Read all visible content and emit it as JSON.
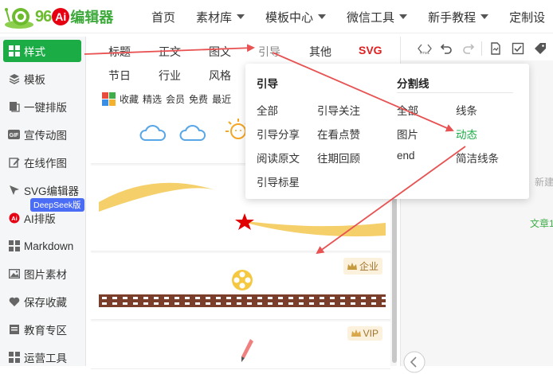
{
  "logo": {
    "num": "96",
    "ai": "Ai",
    "text": "编辑器"
  },
  "nav": [
    {
      "label": "首页",
      "caret": false
    },
    {
      "label": "素材库",
      "caret": true
    },
    {
      "label": "模板中心",
      "caret": true
    },
    {
      "label": "微信工具",
      "caret": true
    },
    {
      "label": "新手教程",
      "caret": true
    },
    {
      "label": "定制设",
      "caret": false
    }
  ],
  "sidebar": {
    "items": [
      {
        "label": "样式",
        "icon": "grid-icon"
      },
      {
        "label": "模板",
        "icon": "layers-icon"
      },
      {
        "label": "一键排版",
        "icon": "format-icon"
      },
      {
        "label": "宣传动图",
        "icon": "gif-icon"
      },
      {
        "label": "在线作图",
        "icon": "edit-icon"
      },
      {
        "label": "SVG编辑器",
        "icon": "pointer-icon"
      },
      {
        "label": "AI排版",
        "icon": "ai-icon"
      },
      {
        "label": "Markdown",
        "icon": "grid-icon"
      },
      {
        "label": "图片素材",
        "icon": "image-icon"
      },
      {
        "label": "保存收藏",
        "icon": "heart-icon"
      },
      {
        "label": "教育专区",
        "icon": "book-icon"
      },
      {
        "label": "运营工具",
        "icon": "grid-icon"
      }
    ],
    "deepseek_badge": "DeepSeek版"
  },
  "tabs": {
    "row1": [
      "标题",
      "正文",
      "图文",
      "引导",
      "其他",
      "SVG"
    ],
    "row2": [
      "节日",
      "行业",
      "风格"
    ]
  },
  "filters": [
    "收藏",
    "精选",
    "会员",
    "免费",
    "最近"
  ],
  "cards": {
    "tag_enterprise": "企业",
    "tag_vip": "VIP"
  },
  "editor": {
    "toolbar": [
      "html-icon",
      "undo-icon",
      "redo-icon",
      "doc-icon",
      "check-icon",
      "tag-icon"
    ],
    "html_label": "HTML",
    "hint_new": "新建",
    "hint_article": "文章1"
  },
  "dropdown": {
    "col1_title": "引导",
    "col2_title": "分割线",
    "col1": [
      [
        "全部",
        "引导关注"
      ],
      [
        "引导分享",
        "在看点赞"
      ],
      [
        "阅读原文",
        "往期回顾"
      ],
      [
        "引导标星",
        ""
      ]
    ],
    "col2": [
      [
        "全部",
        "线条"
      ],
      [
        "图片",
        "动态"
      ],
      [
        "end",
        "简洁线条"
      ]
    ]
  },
  "colors": {
    "accent": "#1bac45",
    "svg_red": "#e02020",
    "arrow": "#e85252",
    "badge": "#4b6cf5"
  }
}
